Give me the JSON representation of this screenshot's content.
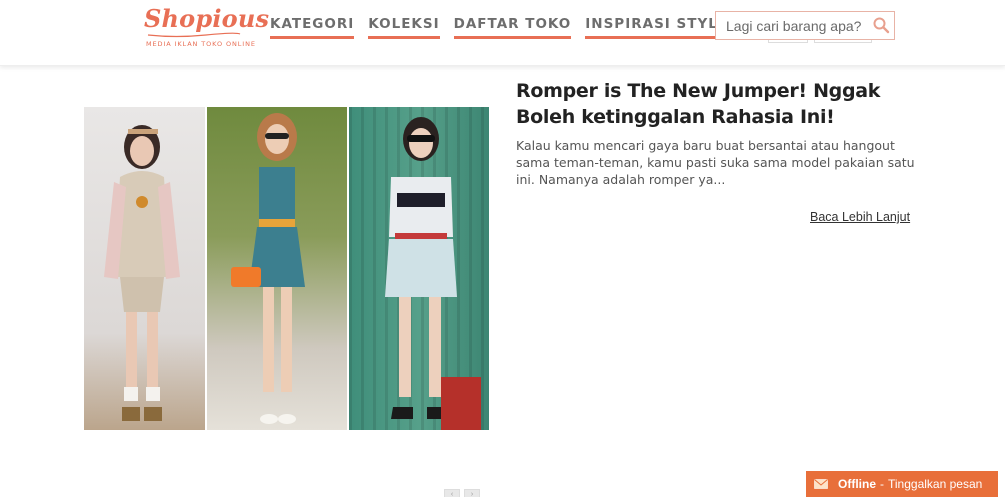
{
  "brand": {
    "name": "Shopious",
    "tagline": "MEDIA IKLAN TOKO ONLINE",
    "accent_color": "#e86f55"
  },
  "nav": {
    "items": [
      {
        "label": "KATEGORI"
      },
      {
        "label": "KOLEKSI"
      },
      {
        "label": "DAFTAR TOKO"
      },
      {
        "label": "INSPIRASI STYLE"
      }
    ]
  },
  "search": {
    "placeholder": "Lagi cari barang apa?",
    "value": "",
    "icon": "search-icon"
  },
  "article": {
    "title": "Romper is The New Jumper! Nggak Boleh ketinggalan Rahasia Ini!",
    "excerpt": "Kalau kamu mencari gaya baru buat bersantai atau hangout sama teman-teman, kamu pasti suka sama model pakaian satu ini. Namanya adalah romper ya...",
    "read_more": "Baca Lebih Lanjut"
  },
  "pager": {
    "prev": "‹",
    "next": "›"
  },
  "chat": {
    "status": "Offline",
    "separator": "-",
    "message": "Tinggalkan pesan",
    "color": "#e86f3a",
    "icon": "mail-icon"
  }
}
